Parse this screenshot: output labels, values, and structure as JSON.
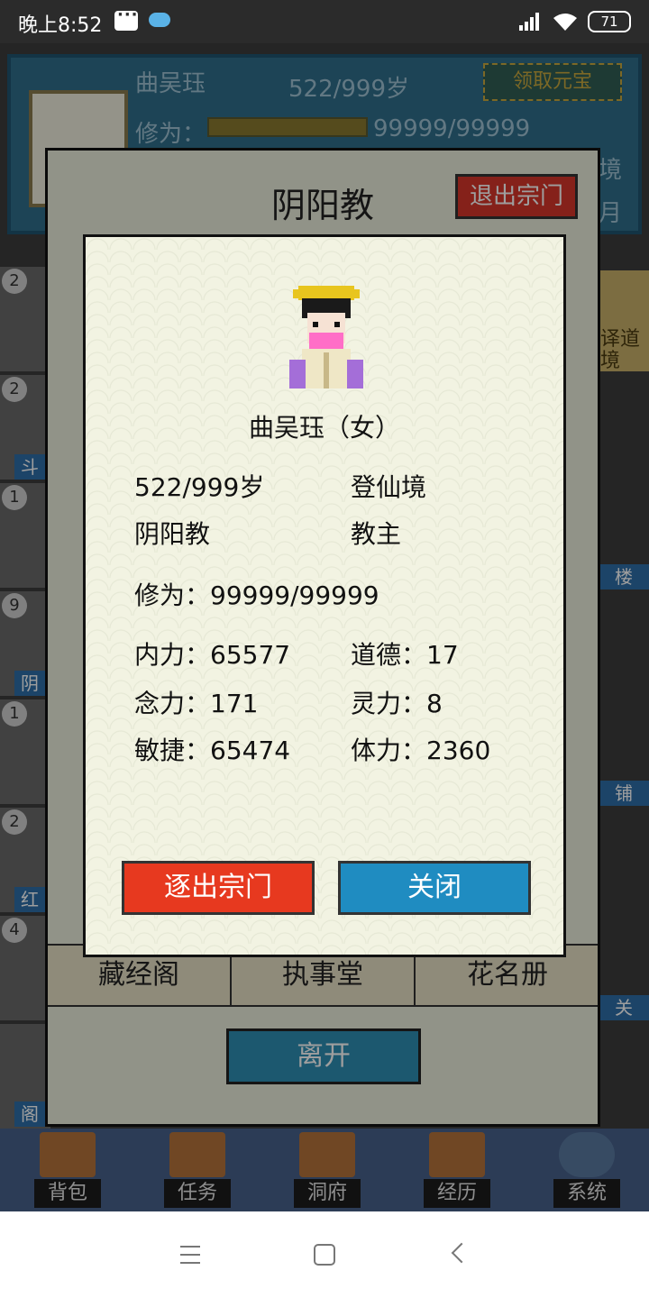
{
  "status_bar": {
    "time": "晚上8:52",
    "battery": "71",
    "icons": [
      "message-icon",
      "cloud-icon",
      "signal-icon",
      "wifi-icon",
      "battery-icon"
    ]
  },
  "profile": {
    "name": "曲吴珏",
    "age": "522/999岁",
    "claim_label": "领取元宝",
    "cultivation_label": "修为：",
    "cultivation_value": "99999/99999",
    "side_text_1": "境",
    "side_text_2": "月"
  },
  "background_list": {
    "badges": [
      "2",
      "2",
      "1",
      "9",
      "1",
      "2",
      "4"
    ],
    "left_labels": [
      "斗",
      "阴",
      "红",
      "阁"
    ],
    "right_labels": [
      "楼",
      "铺",
      "关"
    ],
    "right_card_text_1": "译道",
    "right_card_text_2": "境"
  },
  "sect_window": {
    "title": "阴阳教",
    "leave_button": "退出宗门",
    "tabs": [
      "藏经阁",
      "执事堂",
      "花名册"
    ],
    "depart_button": "离开"
  },
  "member": {
    "name_line": "曲吴珏（女）",
    "age": "522/999岁",
    "realm": "登仙境",
    "sect": "阴阳教",
    "position": "教主",
    "cultivation": "修为：99999/99999",
    "stats": {
      "neili": "内力：65577",
      "daode": "道德：17",
      "nianli": "念力：171",
      "lingli": "灵力：8",
      "minjie": "敏捷：65474",
      "tili": "体力：2360"
    },
    "expel_button": "逐出宗门",
    "close_button": "关闭"
  },
  "bottom_nav": [
    "背包",
    "任务",
    "洞府",
    "经历",
    "系统"
  ],
  "colors": {
    "dialog_bg": "#f2f3e2",
    "expel_red": "#e7391f",
    "close_blue": "#1f8cc1",
    "header_teal": "#2f6f8c"
  }
}
